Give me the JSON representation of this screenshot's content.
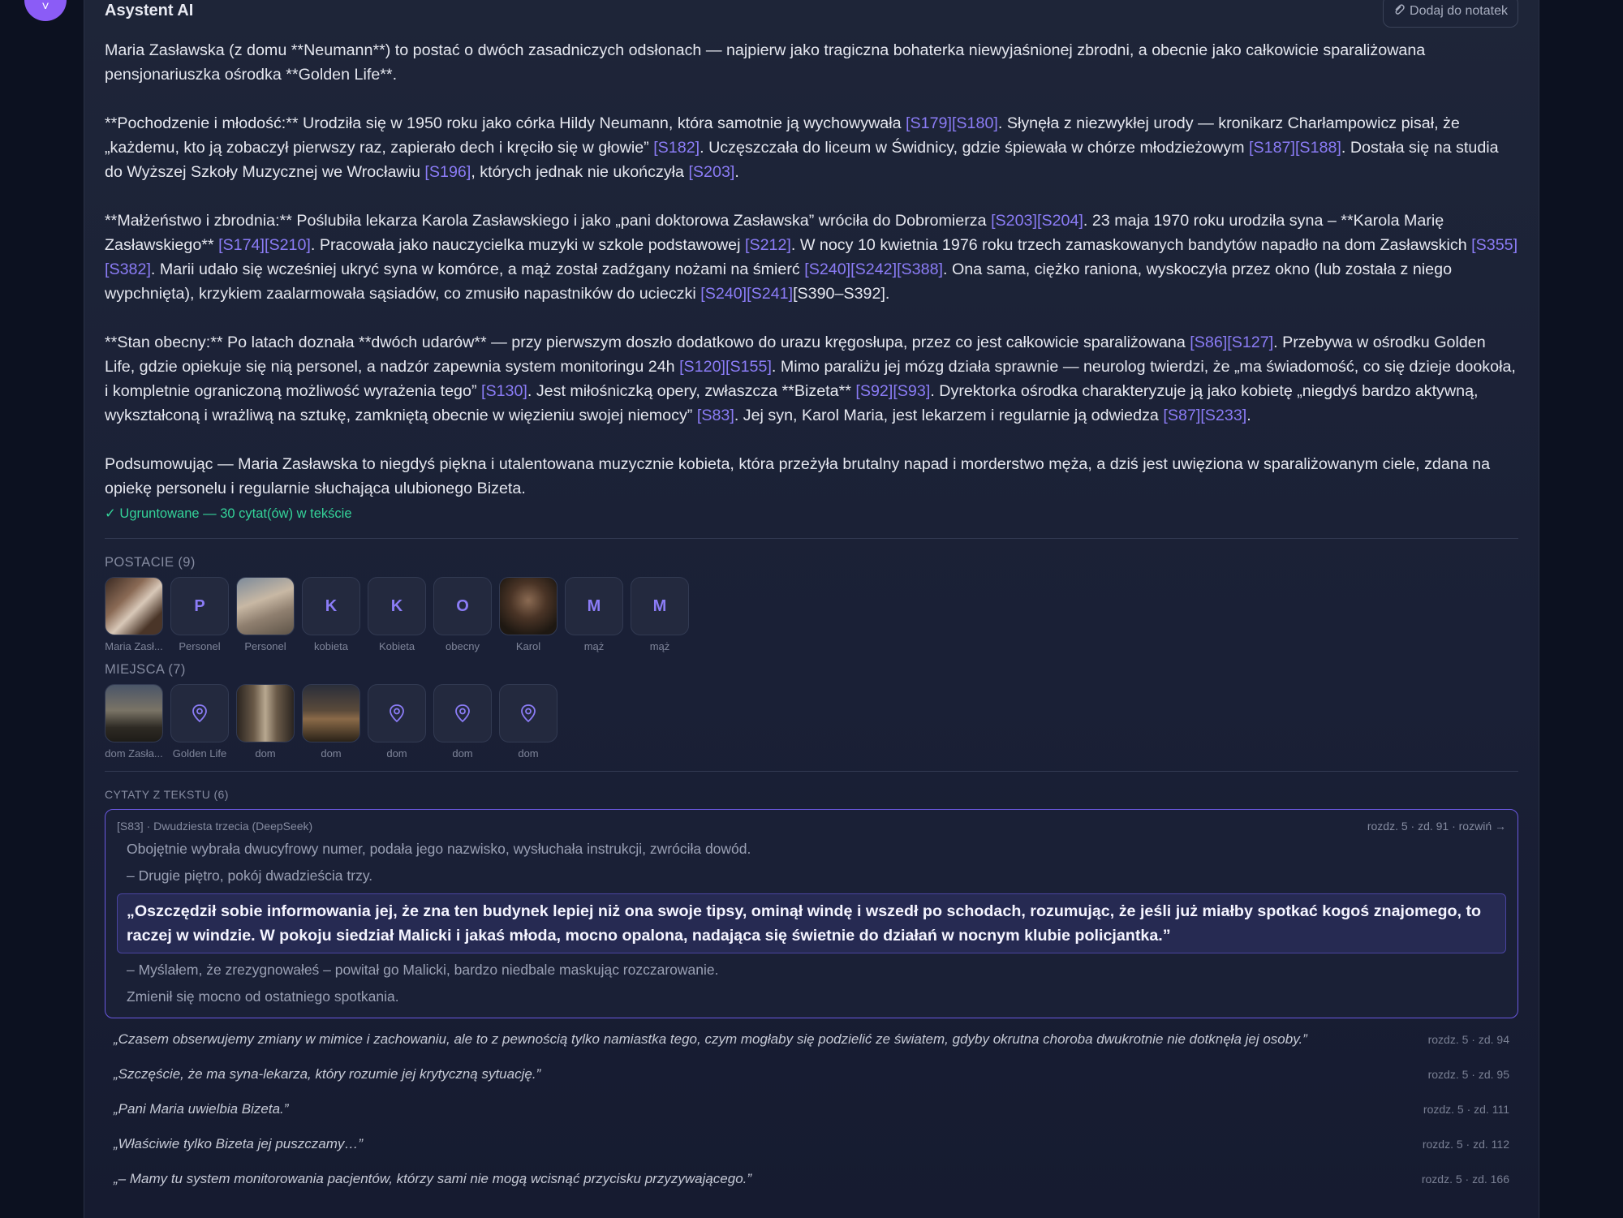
{
  "header": {
    "title": "Asystent AI",
    "note_button": "Dodaj do notatek"
  },
  "answer": {
    "p1": "Maria Zasławska (z domu **Neumann**) to postać o dwóch zasadniczych odsłonach — najpierw jako tragiczna bohaterka niewyjaśnionej zbrodni, a obecnie jako całkowicie sparaliżowana pensjonariuszka ośrodka **Golden Life**.",
    "p2": [
      {
        "t": "**Pochodzenie i młodość:** Urodziła się w 1950 roku jako córka Hildy Neumann, która samotnie ją wychowywała "
      },
      {
        "c": "[S179][S180]"
      },
      {
        "t": ". Słynęła z niezwykłej urody — kronikarz Charłampowicz pisał, że „każdemu, kto ją zobaczył pierwszy raz, zapierało dech i kręciło się w głowie” "
      },
      {
        "c": "[S182]"
      },
      {
        "t": ". Uczęszczała do liceum w Świdnicy, gdzie śpiewała w chórze młodzieżowym "
      },
      {
        "c": "[S187][S188]"
      },
      {
        "t": ". Dostała się na studia do Wyższej Szkoły Muzycznej we Wrocławiu "
      },
      {
        "c": "[S196]"
      },
      {
        "t": ", których jednak nie ukończyła "
      },
      {
        "c": "[S203]"
      },
      {
        "t": "."
      }
    ],
    "p3": [
      {
        "t": "**Małżeństwo i zbrodnia:** Poślubiła lekarza Karola Zasławskiego i jako „pani doktorowa Zasławska” wróciła do Dobromierza "
      },
      {
        "c": "[S203][S204]"
      },
      {
        "t": ". 23 maja 1970 roku urodziła syna – **Karola Marię Zasławskiego** "
      },
      {
        "c": "[S174][S210]"
      },
      {
        "t": ". Pracowała jako nauczycielka muzyki w szkole podstawowej "
      },
      {
        "c": "[S212]"
      },
      {
        "t": ". W nocy 10 kwietnia 1976 roku trzech zamaskowanych bandytów napadło na dom Zasławskich "
      },
      {
        "c": "[S355][S382]"
      },
      {
        "t": ". Marii udało się wcześniej ukryć syna w komórce, a mąż został zadźgany nożami na śmierć "
      },
      {
        "c": "[S240][S242][S388]"
      },
      {
        "t": ". Ona sama, ciężko raniona, wyskoczyła przez okno (lub została z niego wypchnięta), krzykiem zaalarmowała sąsiadów, co zmusiło napastników do ucieczki "
      },
      {
        "c": "[S240][S241]"
      },
      {
        "t": "[S390–S392]."
      }
    ],
    "p4": [
      {
        "t": "**Stan obecny:** Po latach doznała **dwóch udarów** — przy pierwszym doszło dodatkowo do urazu kręgosłupa, przez co jest całkowicie sparaliżowana "
      },
      {
        "c": "[S86][S127]"
      },
      {
        "t": ". Przebywa w ośrodku Golden Life, gdzie opiekuje się nią personel, a nadzór zapewnia system monitoringu 24h "
      },
      {
        "c": "[S120][S155]"
      },
      {
        "t": ". Mimo paraliżu jej mózg działa sprawnie — neurolog twierdzi, że „ma świadomość, co się dzieje dookoła, i kompletnie ograniczoną możliwość wyrażenia tego” "
      },
      {
        "c": "[S130]"
      },
      {
        "t": ". Jest miłośniczką opery, zwłaszcza **Bizeta** "
      },
      {
        "c": "[S92][S93]"
      },
      {
        "t": ". Dyrektorka ośrodka charakteryzuje ją jako kobietę „niegdyś bardzo aktywną, wykształconą i wrażliwą na sztukę, zamkniętą obecnie w więzieniu swojej niemocy” "
      },
      {
        "c": "[S83]"
      },
      {
        "t": ". Jej syn, Karol Maria, jest lekarzem i regularnie ją odwiedza "
      },
      {
        "c": "[S87][S233]"
      },
      {
        "t": "."
      }
    ],
    "p5": "Podsumowując — Maria Zasławska to niegdyś piękna i utalentowana muzycznie kobieta, która przeżyła brutalny napad i morderstwo męża, a dziś jest uwięziona w sparaliżowanym ciele, zdana na opiekę personelu i regularnie słuchająca ulubionego Bizeta.",
    "grounded": "✓ Ugruntowane — 30 cytat(ów) w tekście"
  },
  "characters": {
    "label": "POSTACIE (9)",
    "items": [
      {
        "name": "Maria Zasł...",
        "letter": "",
        "image": "woman-photo"
      },
      {
        "name": "Personel",
        "letter": "P",
        "image": ""
      },
      {
        "name": "Personel",
        "letter": "",
        "image": "family-photo"
      },
      {
        "name": "kobieta",
        "letter": "K",
        "image": ""
      },
      {
        "name": "Kobieta",
        "letter": "K",
        "image": ""
      },
      {
        "name": "obecny",
        "letter": "O",
        "image": ""
      },
      {
        "name": "Karol",
        "letter": "",
        "image": "man-photo"
      },
      {
        "name": "mąż",
        "letter": "M",
        "image": ""
      },
      {
        "name": "mąż",
        "letter": "M",
        "image": ""
      }
    ]
  },
  "places": {
    "label": "MIEJSCA (7)",
    "items": [
      {
        "name": "dom Zasła...",
        "image": "house-photo"
      },
      {
        "name": "Golden Life",
        "image": ""
      },
      {
        "name": "dom",
        "image": "doorway-photo"
      },
      {
        "name": "dom",
        "image": "house-night-photo"
      },
      {
        "name": "dom",
        "image": ""
      },
      {
        "name": "dom",
        "image": ""
      },
      {
        "name": "dom",
        "image": ""
      }
    ]
  },
  "quotes": {
    "label": "CYTATY Z TEKSTU (6)",
    "expanded": {
      "source": "[S83] · Dwudziesta trzecia (DeepSeek)",
      "location": "rozdz. 5 · zd. 91 · rozwiń →",
      "before": [
        "Obojętnie wybrała dwucyfrowy numer, podała jego nazwisko, wysłuchała instrukcji, zwróciła dowód.",
        "– Drugie piętro, pokój dwadzieścia trzy."
      ],
      "highlight": "„Oszczędził sobie informowania jej, że zna ten budynek lepiej niż ona swoje tipsy, ominął windę i wszedł po schodach, rozumując, że jeśli już miałby spotkać kogoś znajomego, to raczej w windzie. W pokoju siedział Malicki i jakaś młoda, mocno opalona, nadająca się świetnie do działań w nocnym klubie policjantka.”",
      "after": [
        "– Myślałem, że zrezygnowałeś – powitał go Malicki, bardzo niedbale maskując rozczarowanie.",
        "Zmienił się mocno od ostatniego spotkania."
      ]
    },
    "list": [
      {
        "text": "„Czasem obserwujemy zmiany w mimice i zachowaniu, ale to z pewnością tylko namiastka tego, czym mogłaby się podzielić ze światem, gdyby okrutna choroba dwukrotnie nie dotknęła jej osoby.”",
        "ref": "rozdz. 5 · zd. 94"
      },
      {
        "text": "„Szczęście, że ma syna-lekarza, który rozumie jej krytyczną sytuację.”",
        "ref": "rozdz. 5 · zd. 95"
      },
      {
        "text": "„Pani Maria uwielbia Bizeta.”",
        "ref": "rozdz. 5 · zd. 111"
      },
      {
        "text": "„Właściwie tylko Bizeta jej puszczamy…”",
        "ref": "rozdz. 5 · zd. 112"
      },
      {
        "text": "„– Mamy tu system monitorowania pacjentów, którzy sami nie mogą wcisnąć przycisku przyzywającego.”",
        "ref": "rozdz. 5 · zd. 166"
      }
    ]
  },
  "colors": {
    "accent": "#8b7cf6",
    "grounded": "#34d399",
    "panel": "#1e2538",
    "background": "#0c1120"
  }
}
